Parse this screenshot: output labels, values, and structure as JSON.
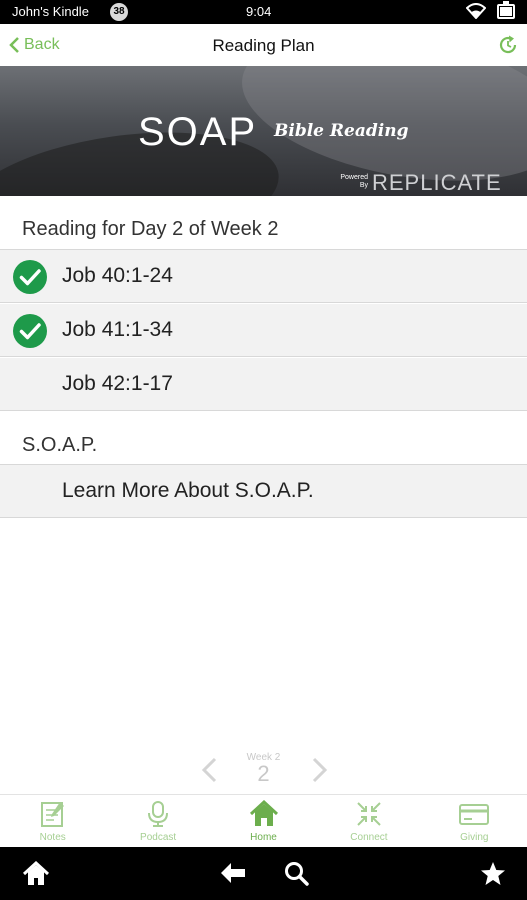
{
  "status_bar": {
    "owner": "John's Kindle",
    "badge": "38",
    "time": "9:04"
  },
  "app_bar": {
    "back_label": "Back",
    "title": "Reading Plan"
  },
  "banner": {
    "title": "SOAP",
    "script": "Bible Reading",
    "powered_by": "Powered By",
    "brand": "REPLICATE"
  },
  "reading": {
    "header": "Reading for Day 2 of Week 2",
    "items": [
      {
        "label": "Job 40:1-24",
        "completed": true
      },
      {
        "label": "Job 41:1-34",
        "completed": true
      },
      {
        "label": "Job 42:1-17",
        "completed": false
      }
    ]
  },
  "soap_section": {
    "header": "S.O.A.P.",
    "link": "Learn More About S.O.A.P."
  },
  "pager": {
    "week_label": "Week 2",
    "week_number": "2"
  },
  "tabs": [
    {
      "label": "Notes",
      "icon": "notes-icon"
    },
    {
      "label": "Podcast",
      "icon": "podcast-icon"
    },
    {
      "label": "Home",
      "icon": "home-icon",
      "active": true
    },
    {
      "label": "Connect",
      "icon": "connect-icon"
    },
    {
      "label": "Giving",
      "icon": "giving-icon"
    }
  ],
  "colors": {
    "accent": "#78be59",
    "check": "#1e9a4a",
    "row_bg": "#f2f2f2"
  }
}
